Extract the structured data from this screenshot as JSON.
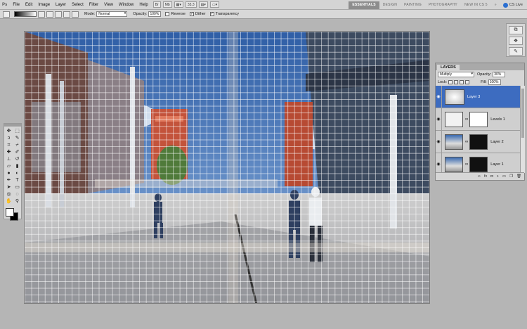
{
  "app": {
    "logo": "Ps"
  },
  "menu": [
    "File",
    "Edit",
    "Image",
    "Layer",
    "Select",
    "Filter",
    "View",
    "Window",
    "Help"
  ],
  "menubar": {
    "zoom": "33.3"
  },
  "workspaces": [
    "ESSENTIALS",
    "DESIGN",
    "PAINTING",
    "PHOTOGRAPHY",
    "NEW IN CS 5"
  ],
  "workspace_more": "»",
  "cs_live": "CS Live",
  "options": {
    "mode_label": "Mode:",
    "mode_value": "Normal",
    "opacity_label": "Opacity:",
    "opacity_value": "100%",
    "reverse": "Reverse",
    "dither": "Dither",
    "transparency": "Transparency"
  },
  "layers_panel": {
    "tab": "LAYERS",
    "blend_mode": "Multiply",
    "opacity_label": "Opacity:",
    "opacity_value": "30%",
    "lock_label": "Lock:",
    "fill_label": "Fill:",
    "fill_value": "100%",
    "layers": [
      {
        "name": "Layer 3",
        "selected": true
      },
      {
        "name": "Levels 1",
        "selected": false
      },
      {
        "name": "Layer 2",
        "selected": false
      },
      {
        "name": "Layer 1",
        "selected": false
      }
    ]
  },
  "colors": {
    "selection": "#3d6cc0",
    "chrome": "#d6d6d6",
    "workspace_bg": "#b5b5b5"
  }
}
